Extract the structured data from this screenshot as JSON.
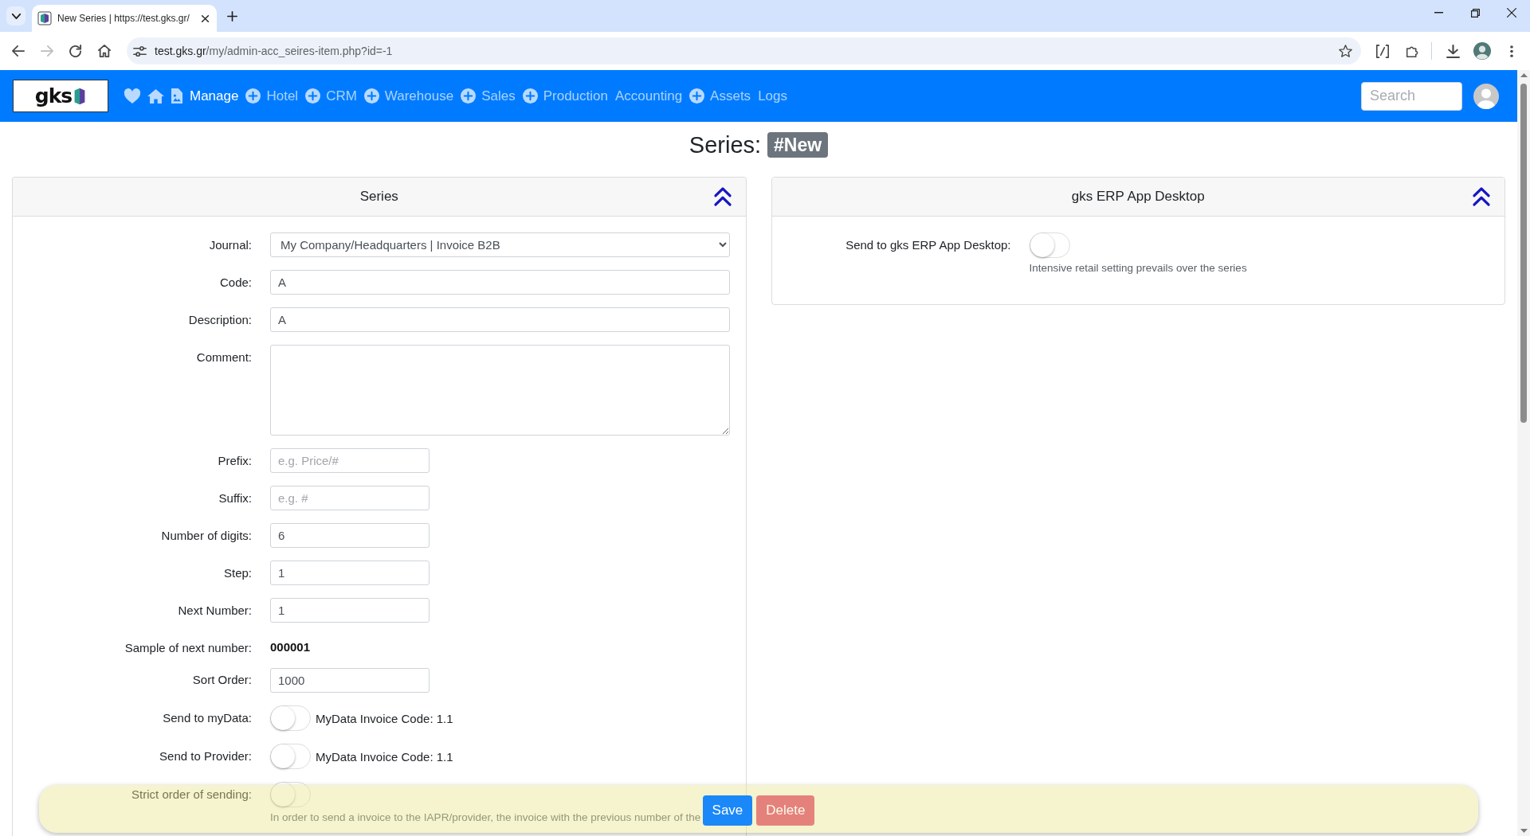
{
  "browser": {
    "tab_title": "New Series | https://test.gks.gr/",
    "url_host": "test.gks.gr",
    "url_path": "/my/admin-acc_seires-item.php?id=-1",
    "nav_buttons": [
      {
        "kind": "back",
        "disabled": false
      },
      {
        "kind": "forward",
        "disabled": true
      },
      {
        "kind": "reload",
        "disabled": false
      },
      {
        "kind": "home",
        "disabled": false
      }
    ]
  },
  "navbar": {
    "logo_text": "gks",
    "menu": [
      {
        "label": "Manage",
        "selected": true,
        "expandable": false
      },
      {
        "label": "Hotel",
        "selected": false,
        "expandable": true
      },
      {
        "label": "CRM",
        "selected": false,
        "expandable": true
      },
      {
        "label": "Warehouse",
        "selected": false,
        "expandable": true
      },
      {
        "label": "Sales",
        "selected": false,
        "expandable": true
      },
      {
        "label": "Production",
        "selected": false,
        "expandable": true
      },
      {
        "label": "Accounting",
        "selected": false,
        "expandable": false
      },
      {
        "label": "Assets",
        "selected": false,
        "expandable": true
      },
      {
        "label": "Logs",
        "selected": false,
        "expandable": false
      }
    ],
    "search": {
      "placeholder": "Search"
    }
  },
  "heading": {
    "title": "Series:",
    "badge": "#New"
  },
  "cards": [
    {
      "title": "Series",
      "expanded": true,
      "rows": [
        {
          "kind": "select",
          "label": "Journal:",
          "value": "My Company/Headquarters | Invoice B2B"
        },
        {
          "kind": "input",
          "label": "Code:",
          "value": "A"
        },
        {
          "kind": "input",
          "label": "Description:",
          "value": "A"
        },
        {
          "kind": "textarea",
          "label": "Comment:"
        },
        {
          "kind": "short_input",
          "label": "Prefix:",
          "placeholder": "e.g. Price/#"
        },
        {
          "kind": "short_input",
          "label": "Suffix:",
          "placeholder": "e.g. #"
        },
        {
          "kind": "short_input",
          "label": "Number of digits:",
          "value": "6"
        },
        {
          "kind": "short_input",
          "label": "Step:",
          "value": "1"
        },
        {
          "kind": "short_input",
          "label": "Next Number:",
          "value": "1"
        },
        {
          "kind": "value",
          "label": "Sample of next number:",
          "value": "000001"
        },
        {
          "kind": "short_input",
          "label": "Sort Order:",
          "value": "1000"
        },
        {
          "kind": "toggle",
          "label": "Send to myData:",
          "on": false,
          "note": "MyData Invoice Code: 1.1"
        },
        {
          "kind": "toggle",
          "label": "Send to Provider:",
          "on": false,
          "note": "MyData Invoice Code: 1.1"
        },
        {
          "kind": "toggle",
          "label": "Strict order of sending:",
          "on": false,
          "help": "In order to send a invoice to the IAPR/provider, the invoice with the previous number of the"
        }
      ]
    },
    {
      "title": "gks ERP App Desktop",
      "expanded": true,
      "rows": [
        {
          "kind": "toggle",
          "label": "Send to gks ERP App Desktop:",
          "on": false,
          "help": "Intensive retail setting prevails over the series"
        }
      ]
    }
  ],
  "footer": {
    "buttons": [
      {
        "label": "Save",
        "kind": "primary",
        "disabled": false
      },
      {
        "label": "Delete",
        "kind": "danger",
        "disabled": true
      }
    ]
  }
}
